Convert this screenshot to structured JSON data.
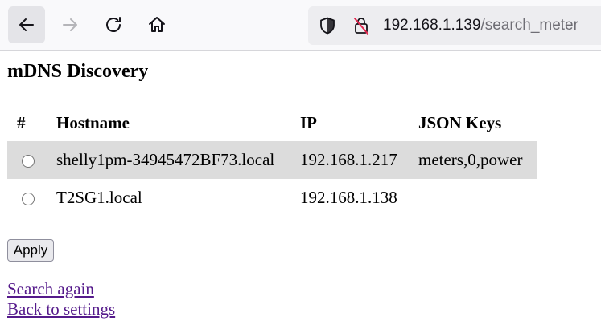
{
  "browser": {
    "url_host": "192.168.1.139",
    "url_path": "/search_meter",
    "icons": [
      "back-arrow-icon",
      "forward-arrow-icon",
      "reload-icon",
      "home-icon",
      "shield-icon",
      "insecure-lock-icon"
    ]
  },
  "page": {
    "title": "mDNS Discovery",
    "table": {
      "headers": [
        "#",
        "Hostname",
        "IP",
        "JSON Keys"
      ],
      "rows": [
        {
          "hostname": "shelly1pm-34945472BF73.local",
          "ip": "192.168.1.217",
          "json_keys": "meters,0,power",
          "selected": false
        },
        {
          "hostname": "T2SG1.local",
          "ip": "192.168.1.138",
          "json_keys": "",
          "selected": false
        }
      ]
    },
    "apply_label": "Apply",
    "links": {
      "search_again": "Search again",
      "back_to_settings": "Back to settings"
    }
  },
  "colors": {
    "link_visited": "#551a8b",
    "highlight_row": "#dcdcdc",
    "insecure_slash": "#e22850"
  }
}
